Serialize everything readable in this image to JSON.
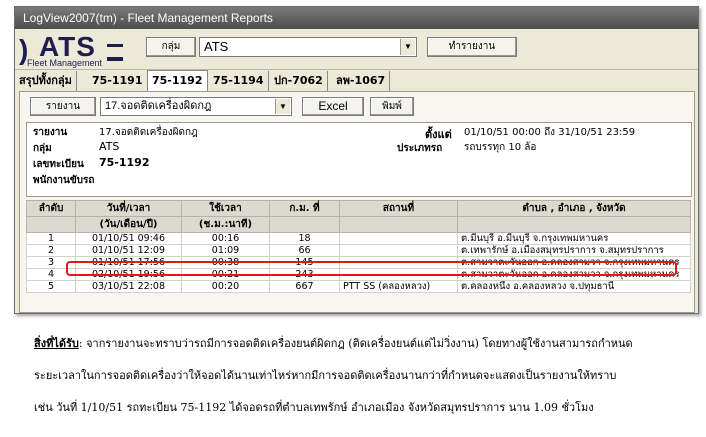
{
  "window": {
    "title": "LogView2007(tm) - Fleet Management Reports"
  },
  "logo": {
    "name": "ATS",
    "subtitle": "Fleet Management"
  },
  "toolbar": {
    "group_label": "กลุ่ม",
    "group_value": "ATS",
    "run_report_label": "ทำรายงาน"
  },
  "tabs": [
    "สรุปทั้งกลุ่ม",
    "75-1191",
    "75-1192",
    "75-1194",
    "ปก-7062",
    "ลพ-1067"
  ],
  "active_tab": "75-1192",
  "report_bar": {
    "report_label": "รายงาน",
    "report_value": "17.จอดติดเครื่องผิดกฎ",
    "excel_label": "Excel",
    "print_label": "พิมพ์"
  },
  "info": {
    "report_lbl": "รายงาน",
    "report_val": "17.จอดติดเครื่องผิดกฎ",
    "group_lbl": "กลุ่ม",
    "group_val": "ATS",
    "plate_lbl": "เลขทะเบียน",
    "plate_val": "75-1192",
    "driver_lbl": "พนักงานขับรถ",
    "since_lbl": "ตั้งแต่",
    "since_val": "01/10/51  00:00 ถึง 31/10/51  23:59",
    "type_lbl": "ประเภทรถ",
    "type_val": "รถบรรทุก 10 ล้อ"
  },
  "table": {
    "headers": [
      "ลำดับ",
      "วันที่/เวลา",
      "ใช้เวลา",
      "ก.ม. ที่",
      "สถานที่",
      "ตำบล , อำเภอ , จังหวัด"
    ],
    "subheaders": [
      "",
      "(วัน/เดือน/ปี)",
      "(ช.ม.:นาที)",
      "",
      "",
      ""
    ],
    "rows": [
      [
        "1",
        "01/10/51  09:46",
        "00:16",
        "18",
        "",
        "ต.มีนบุรี อ.มีนบุรี จ.กรุงเทพมหานคร"
      ],
      [
        "2",
        "01/10/51  12:09",
        "01:09",
        "66",
        "",
        "ต.เทพารักษ์ อ.เมืองสมุทรปราการ จ.สมุทรปราการ"
      ],
      [
        "3",
        "01/10/51  17:56",
        "00:38",
        "145",
        "",
        "ต.สามวาตะวันออก อ.คลองสามวา จ.กรุงเทพมหานคร"
      ],
      [
        "4",
        "02/10/51  19:56",
        "00:21",
        "243",
        "",
        "ต.สามวาตะวันออก อ.คลองสามวา จ.กรุงเทพมหานคร"
      ],
      [
        "5",
        "03/10/51  22:08",
        "00:20",
        "667",
        "PTT SS (คลองหลวง)",
        "ต.คลองหนึ่ง อ.คลองหลวง จ.ปทุมธานี"
      ]
    ]
  },
  "caption": {
    "label": "สิ่งที่ได้รับ",
    "line1": ": จากรายงานจะทราบว่ารถมีการจอดติดเครื่องยนต์ผิดกฎ (ติดเครื่องยนต์แต่ไม่วิ่งงาน) โดยทางผู้ใช้งานสามารถกำหนด",
    "line2": "ระยะเวลาในการจอดติดเครื่องว่าให้จอดได้นานเท่าไหร่หากมีการจอดติดเครื่องนานกว่าที่กำหนดจะแสดงเป็นรายงานให้ทราบ",
    "line3": "เช่น วันที่ 1/10/51 รถทะเบียน 75-1192 ได้จอดรถที่ตำบลเทพรักษ์ อำเภอเมือง จังหวัดสมุทรปราการ นาน 1.09 ชั่วโมง"
  }
}
